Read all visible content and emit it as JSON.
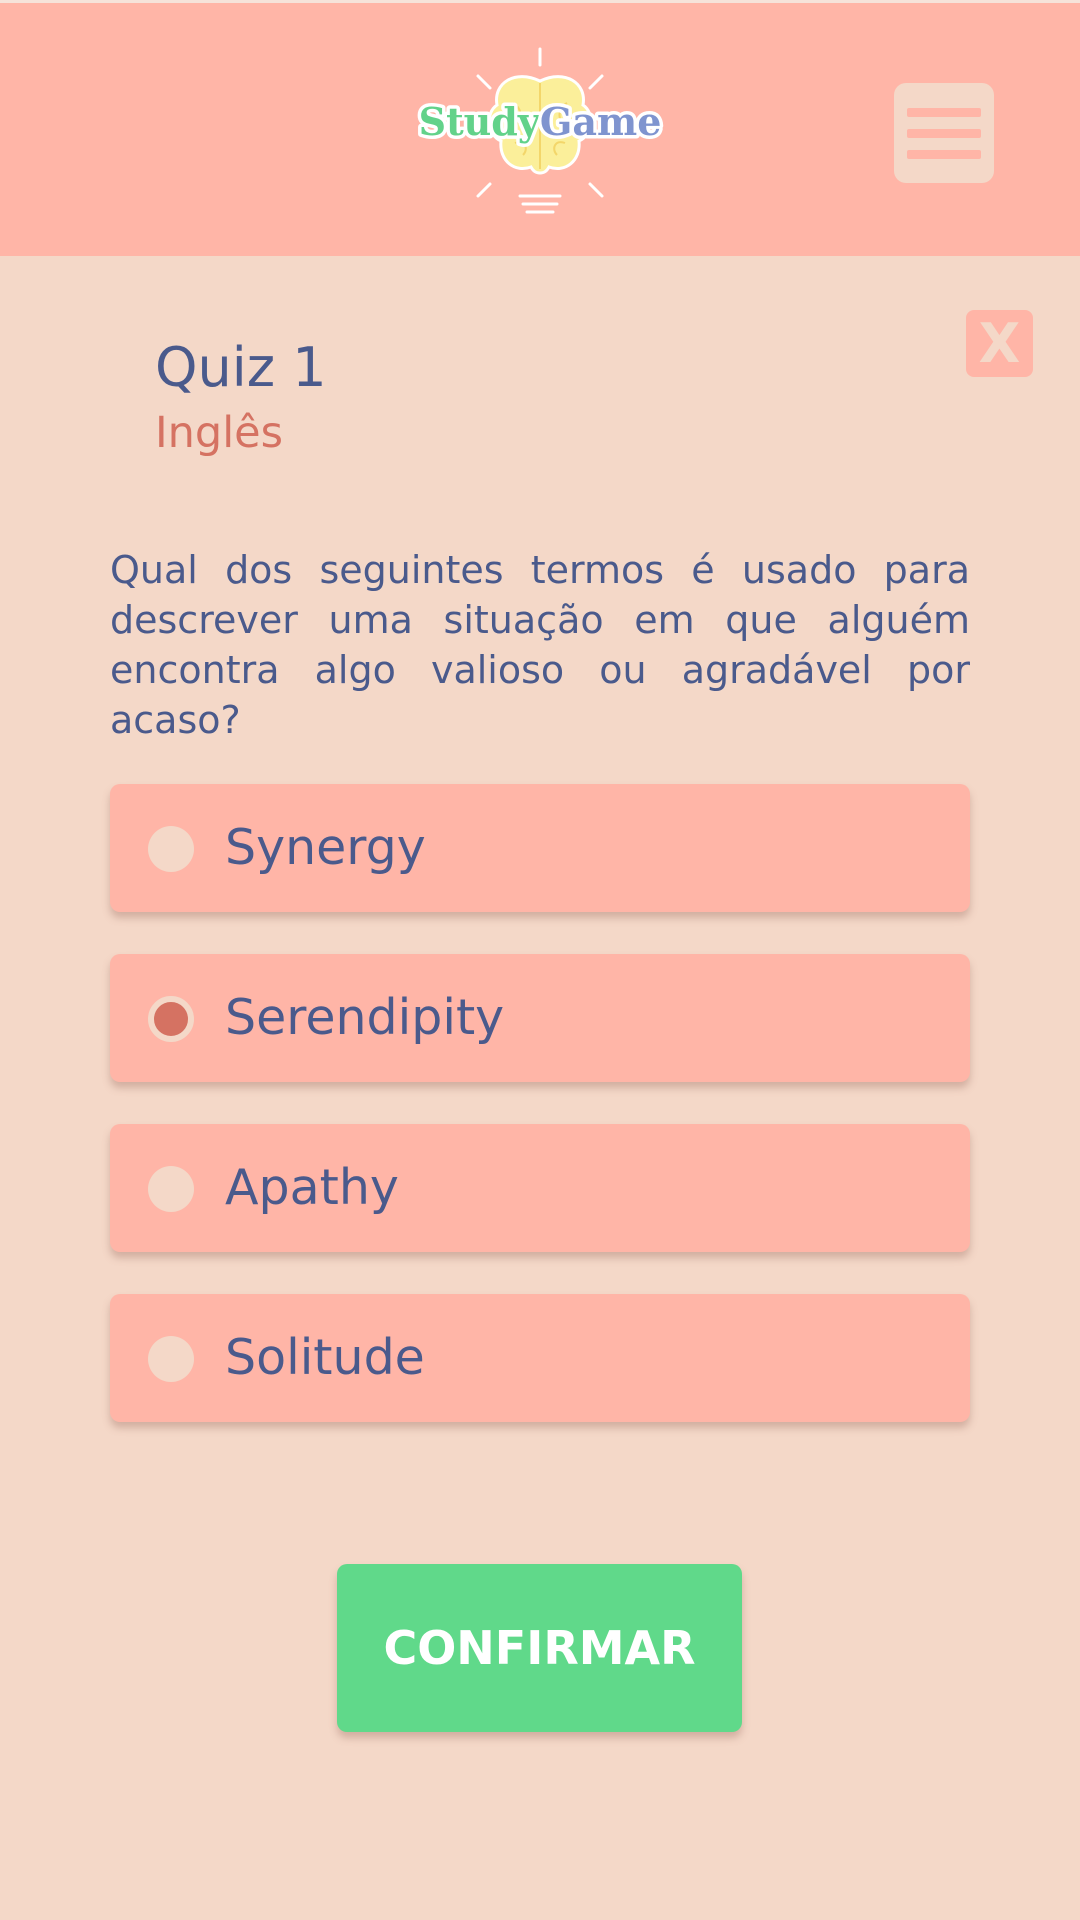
{
  "header": {
    "logo_text_study": "Study",
    "logo_text_game": "Game",
    "menu_icon": "hamburger-menu-icon"
  },
  "quiz": {
    "close_label": "X",
    "title": "Quiz 1",
    "subject": "Inglês",
    "question": "Qual dos seguintes termos é usado para descrever uma situação em que alguém encontra algo valioso ou agradável por acaso?",
    "options": [
      {
        "label": "Synergy",
        "selected": false
      },
      {
        "label": "Serendipity",
        "selected": true
      },
      {
        "label": "Apathy",
        "selected": false
      },
      {
        "label": "Solitude",
        "selected": false
      }
    ],
    "confirm_label": "CONFIRMAR"
  },
  "colors": {
    "background": "#f4d8c8",
    "header": "#ffb5a7",
    "primary_text": "#4a5a8c",
    "accent": "#d57262",
    "confirm": "#60d98a"
  }
}
